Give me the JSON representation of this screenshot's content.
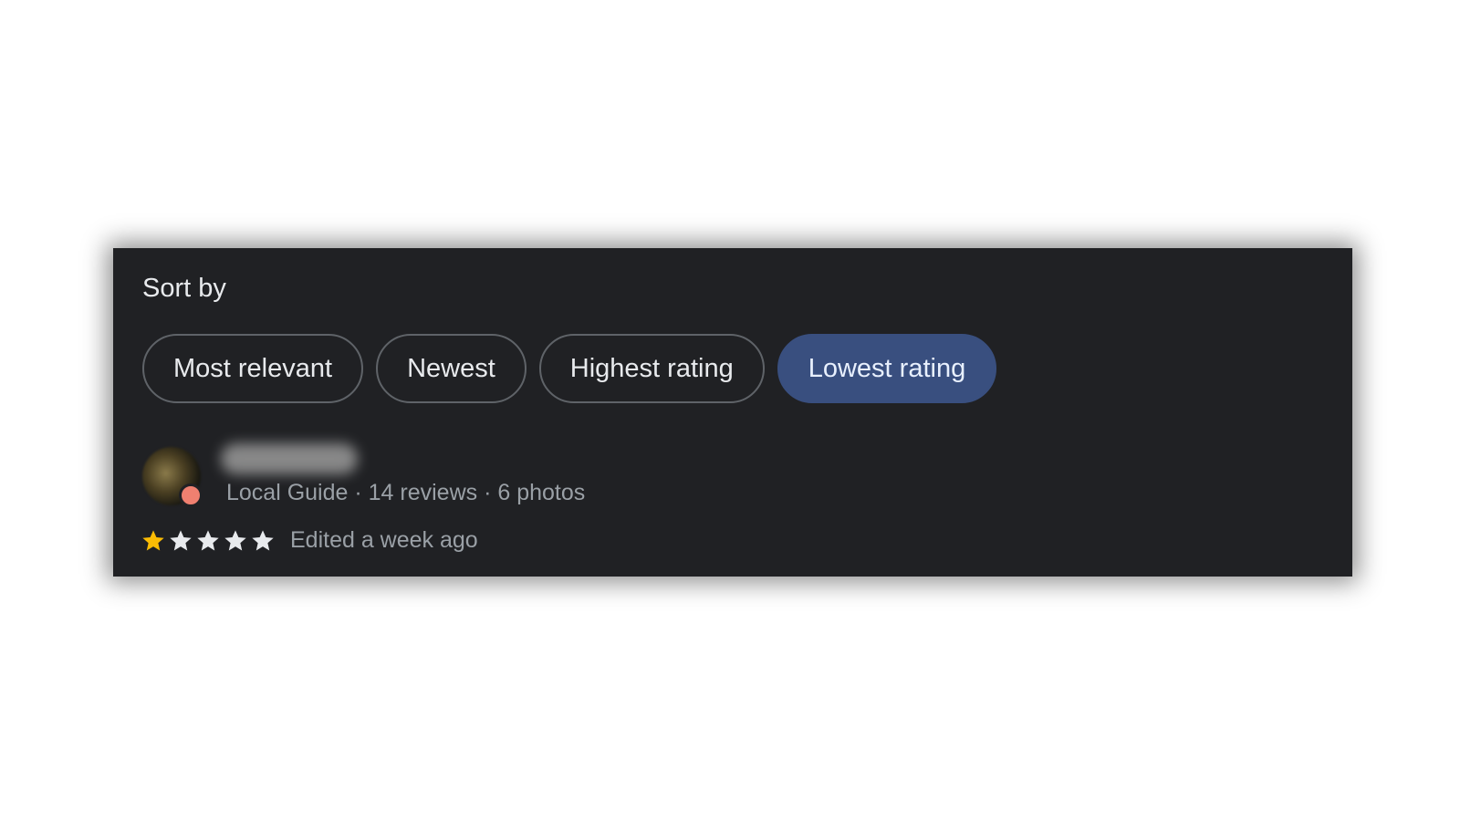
{
  "sort": {
    "title": "Sort by",
    "options": [
      {
        "label": "Most relevant",
        "selected": false
      },
      {
        "label": "Newest",
        "selected": false
      },
      {
        "label": "Highest rating",
        "selected": false
      },
      {
        "label": "Lowest rating",
        "selected": true
      }
    ]
  },
  "review": {
    "reviewer_meta": "Local Guide · 14 reviews · 6 photos",
    "rating": 1,
    "max_rating": 5,
    "date": "Edited a week ago"
  },
  "colors": {
    "panel_bg": "#202124",
    "selected_chip": "#394f7f",
    "star_filled": "#fbbc04",
    "star_empty": "#e8eaed"
  },
  "icons": {
    "avatar": "avatar",
    "star": "star-icon"
  }
}
